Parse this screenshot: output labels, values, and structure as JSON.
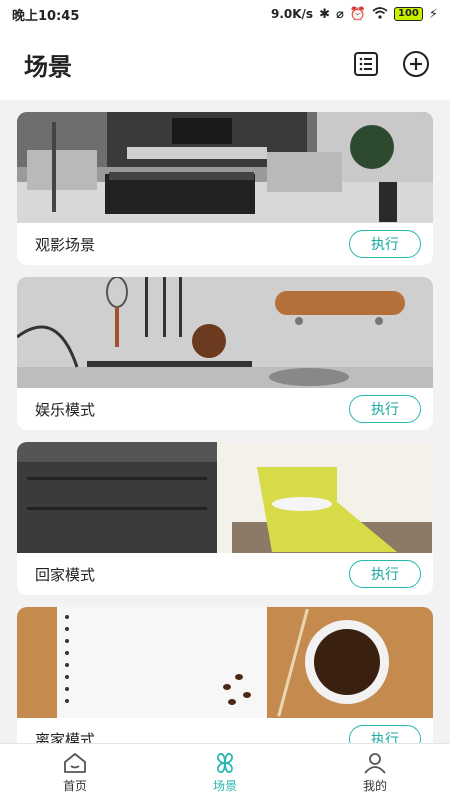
{
  "status": {
    "time": "晚上10:45",
    "speed": "9.0K/s",
    "battery": "100"
  },
  "header": {
    "title": "场景"
  },
  "scenes": [
    {
      "name": "观影场景",
      "action": "执行"
    },
    {
      "name": "娱乐模式",
      "action": "执行"
    },
    {
      "name": "回家模式",
      "action": "执行"
    },
    {
      "name": "离家模式",
      "action": "执行"
    }
  ],
  "nav": {
    "items": [
      {
        "label": "首页",
        "icon": "home-icon"
      },
      {
        "label": "场景",
        "icon": "scene-icon"
      },
      {
        "label": "我的",
        "icon": "profile-icon"
      }
    ],
    "active": 1
  },
  "colors": {
    "accent": "#26b8b0"
  }
}
